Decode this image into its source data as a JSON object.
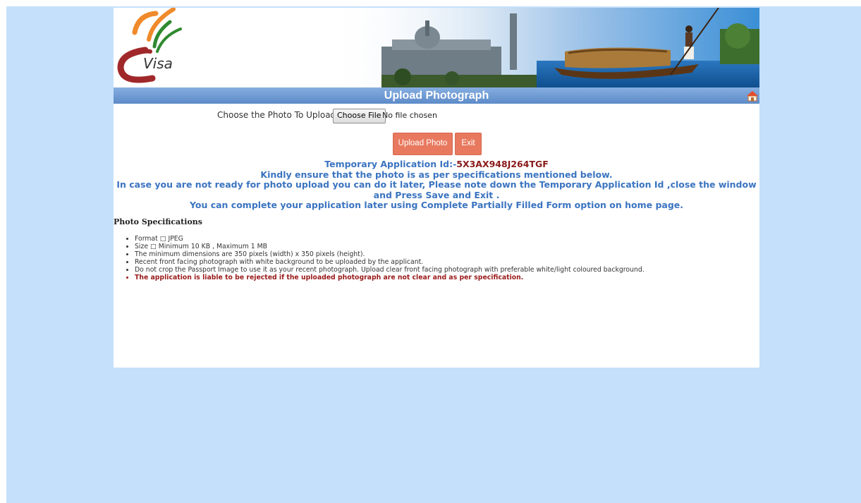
{
  "logo": {
    "text": "Visa"
  },
  "header": {
    "title": "Upload Photograph"
  },
  "upload": {
    "label": "Choose the Photo To Upload",
    "choose_file_label": "Choose File",
    "file_status": "No file chosen"
  },
  "buttons": {
    "upload_label": "Upload Photo",
    "exit_label": "Exit"
  },
  "notice": {
    "appid_label": "Temporary Application Id:-",
    "appid_value": "5X3AX948J264TGF",
    "line2": "Kindly ensure that the photo is as per specifications mentioned below.",
    "line3": "In case you are not ready for photo upload you can do it later, Please note down the Temporary Application Id ,close the window and Press Save and Exit .",
    "line4": "You can complete your application later using Complete Partially Filled Form option on home page."
  },
  "specs": {
    "title": "Photo Specifications",
    "items": [
      "Format □ JPEG",
      "Size □ Minimum 10 KB , Maximum 1 MB",
      "The minimum dimensions are 350 pixels (width) x 350 pixels (height).",
      "Recent front facing photograph with white background to be uploaded by the applicant.",
      "Do not crop the Passport Image to use it as your recent photograph. Upload clear front facing photograph with preferable white/light coloured background."
    ],
    "warning": "The application is liable to be rejected if the uploaded photograph are not clear and as per specification."
  },
  "colors": {
    "page_bg": "#c5e0fb",
    "title_bar": "#6b97d1",
    "button": "#e8795e",
    "notice_text": "#3b74c0",
    "appid_text": "#8a1a1a"
  }
}
